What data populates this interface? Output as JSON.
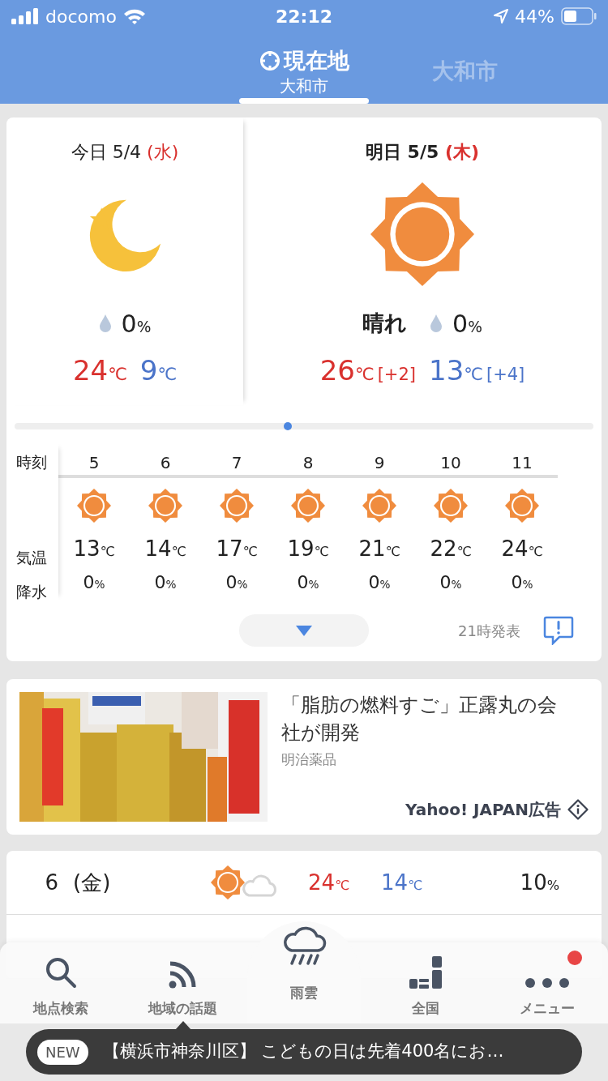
{
  "status_bar": {
    "carrier": "docomo",
    "time": "22:12",
    "battery": "44%"
  },
  "location_tabs": [
    {
      "label": "現在地",
      "sublabel": "大和市",
      "kind": "current",
      "selected": true
    },
    {
      "label": "大和市",
      "kind": "city",
      "selected": false
    }
  ],
  "forecast_days": [
    {
      "day": "今日",
      "date": "5/4",
      "weekday": {
        "text": "(水)",
        "color": "#d9312e"
      },
      "emphasized": false,
      "kind": "moon",
      "precip": "0%",
      "high": "24℃",
      "low": "9℃"
    },
    {
      "day": "明日",
      "date": "5/5",
      "weekday": {
        "text": "(木)",
        "color": "#d9312e"
      },
      "emphasized": true,
      "kind": "sun",
      "condition": "晴れ",
      "precip": "0%",
      "high": "26℃",
      "high_diff": "[+2]",
      "low": "13℃",
      "low_diff": "[+4]"
    }
  ],
  "hourly": {
    "labels": [
      "時刻",
      "気温",
      "降水"
    ],
    "hours": [
      {
        "hour": "5",
        "kind": "sun",
        "temp": "13℃",
        "precip": "0%"
      },
      {
        "hour": "6",
        "kind": "sun",
        "temp": "14℃",
        "precip": "0%"
      },
      {
        "hour": "7",
        "kind": "sun",
        "temp": "17℃",
        "precip": "0%"
      },
      {
        "hour": "8",
        "kind": "sun",
        "temp": "19℃",
        "precip": "0%"
      },
      {
        "hour": "9",
        "kind": "sun",
        "temp": "21℃",
        "precip": "0%"
      },
      {
        "hour": "10",
        "kind": "sun",
        "temp": "22℃",
        "precip": "0%"
      },
      {
        "hour": "11",
        "kind": "sun",
        "temp": "24℃",
        "precip": "0%"
      }
    ],
    "issued": "21時発表"
  },
  "ad": {
    "kind": "picture",
    "headline": "「脂肪の燃料すご」正露丸の会社が開発",
    "source": "明治薬品",
    "sponsor": "Yahoo! JAPAN広告"
  },
  "daily": [
    {
      "day": "6",
      "weekday": {
        "text": "(金)",
        "color": "#222222"
      },
      "kind": "sun_cloud",
      "high": "24℃",
      "low": "14℃",
      "precip": "10%"
    }
  ],
  "bottom_nav": [
    {
      "label": "地点検索",
      "featured": false,
      "badge": false
    },
    {
      "label": "地域の話題",
      "featured": false,
      "badge": false
    },
    {
      "label": "雨雲",
      "featured": true,
      "badge": false
    },
    {
      "label": "全国",
      "featured": false,
      "badge": false
    },
    {
      "label": "メニュー",
      "featured": false,
      "badge": true
    }
  ],
  "toast": {
    "badge": "NEW",
    "text": "【横浜市神奈川区】 こどもの日は先着400名にお…"
  }
}
